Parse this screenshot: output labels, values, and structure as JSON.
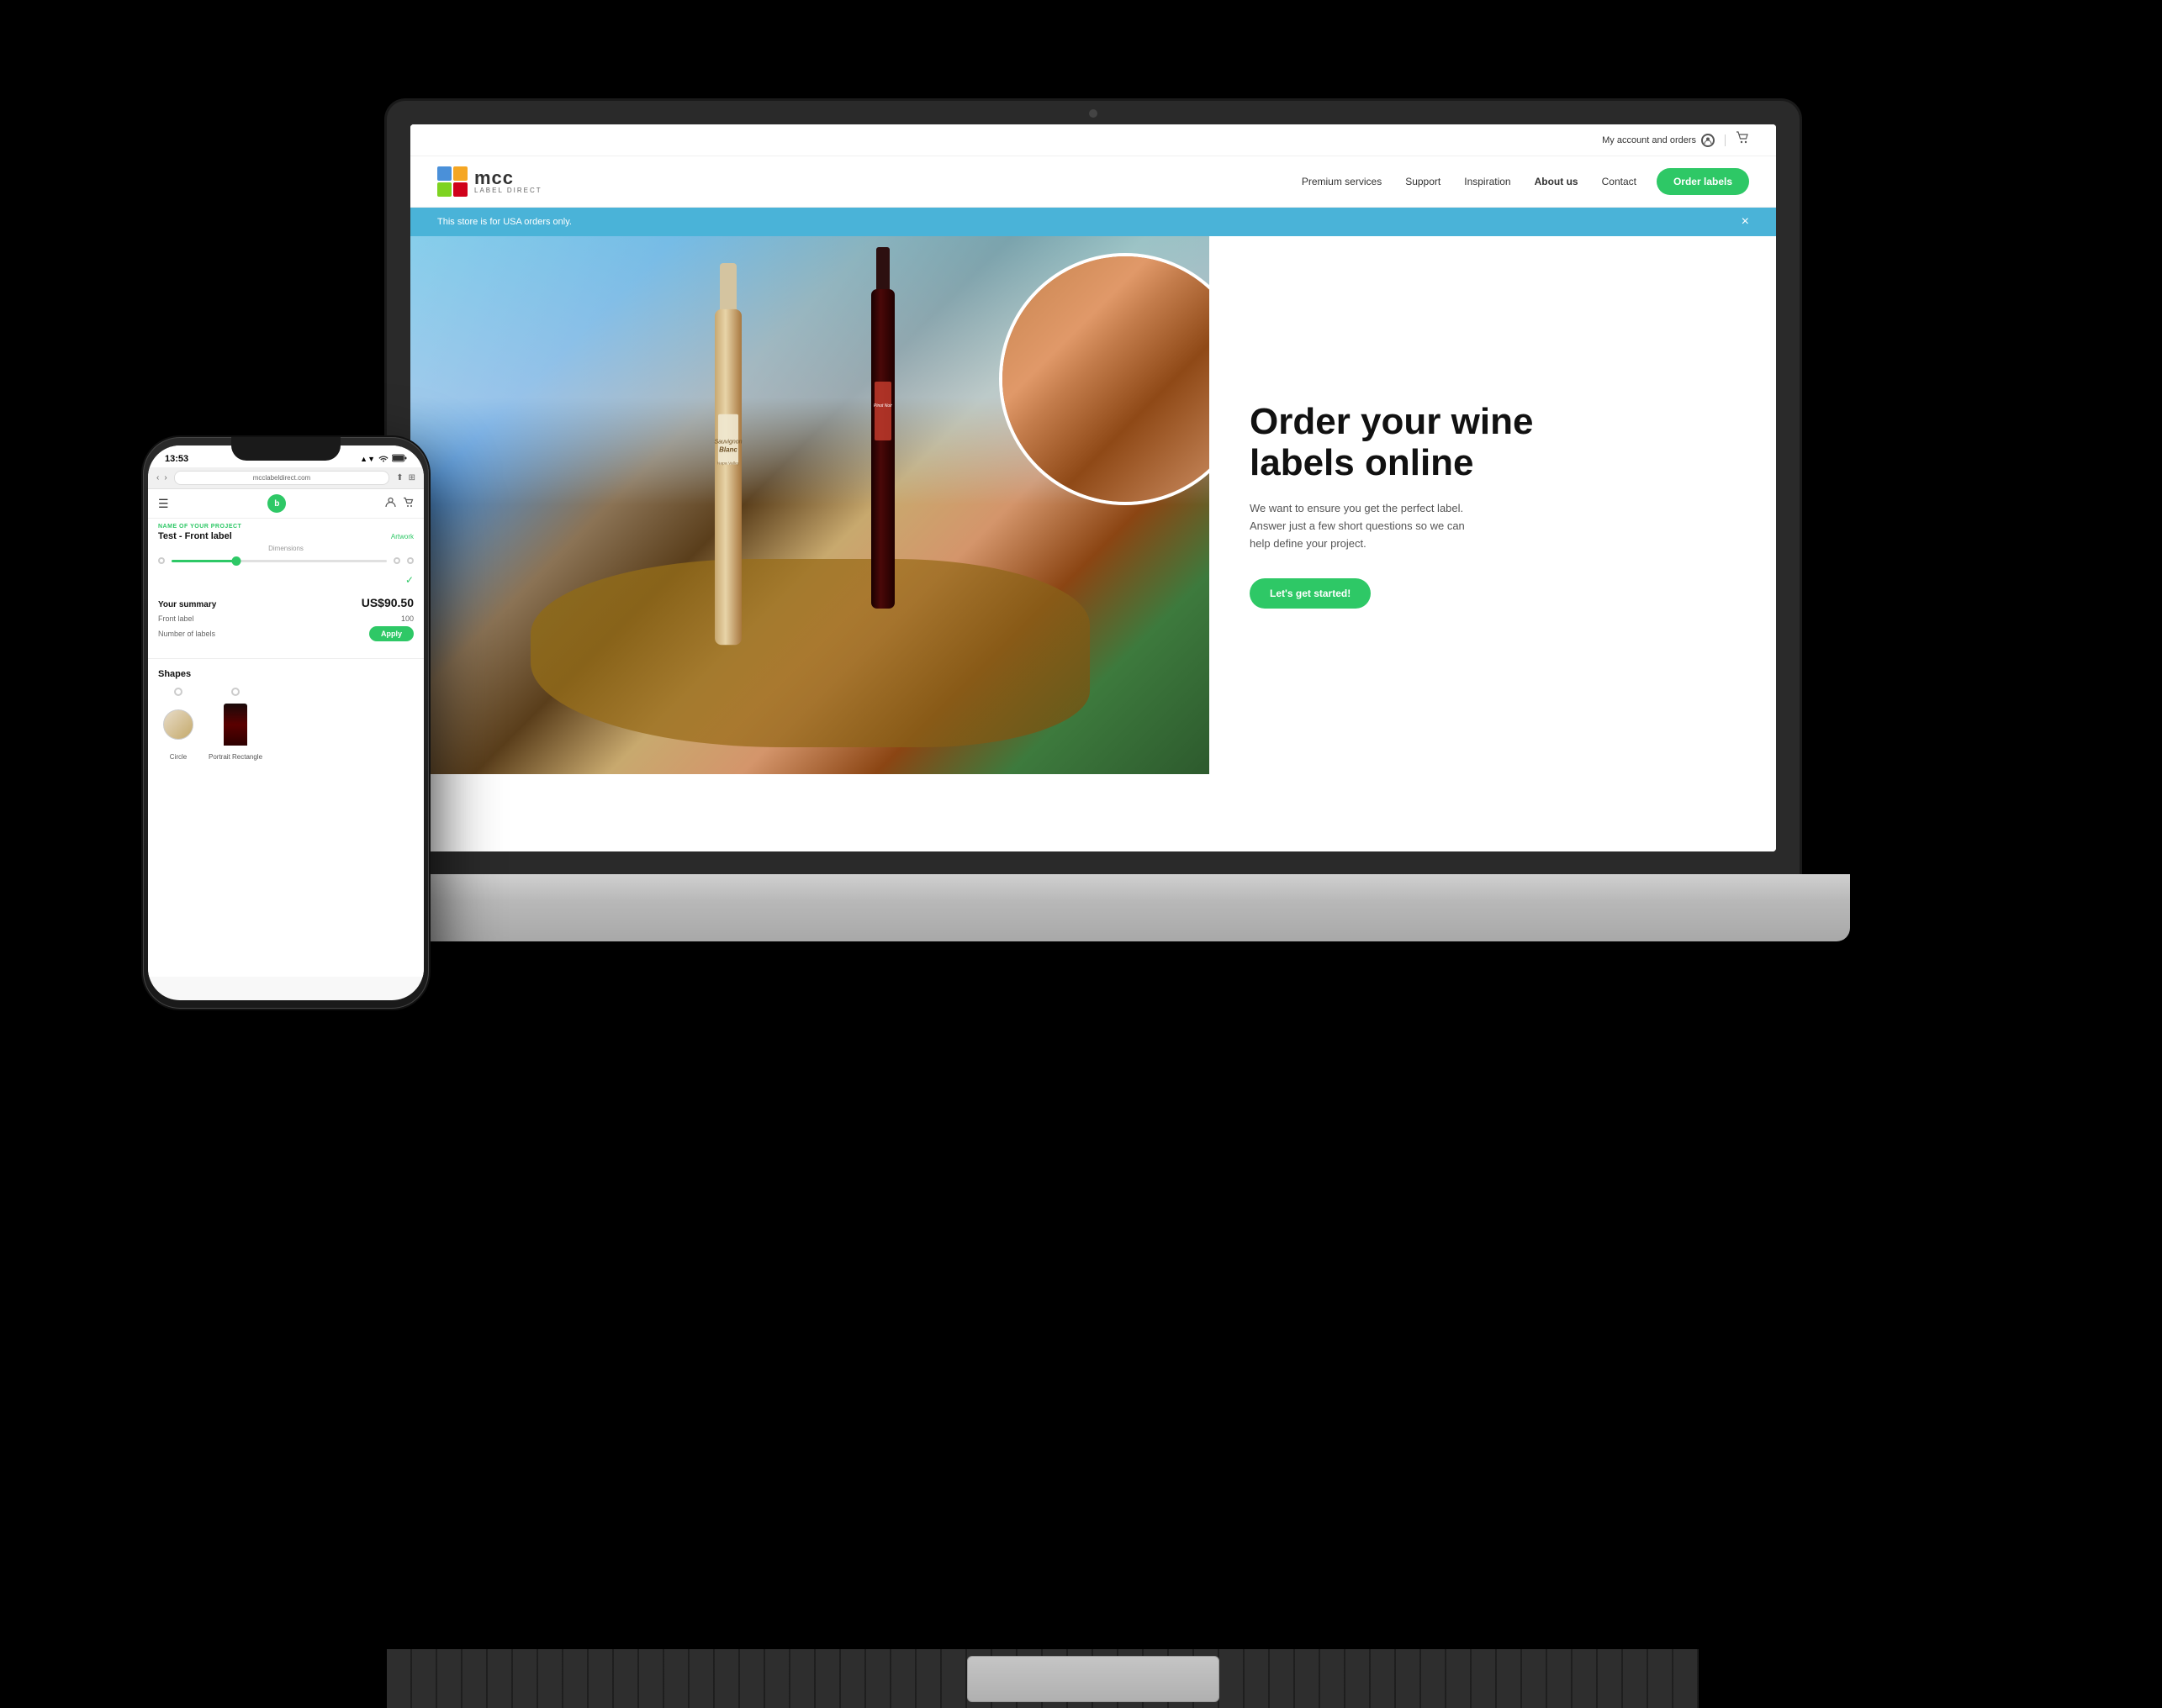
{
  "background": "#000000",
  "laptop": {
    "website": {
      "topbar": {
        "account_label": "My account and orders",
        "divider": true
      },
      "nav": {
        "logo_main": "mcc",
        "logo_sub": "LABEL DIRECT",
        "links": [
          {
            "label": "Premium services"
          },
          {
            "label": "Support"
          },
          {
            "label": "Inspiration"
          },
          {
            "label": "About us"
          },
          {
            "label": "Contact"
          }
        ],
        "cta_button": "Order labels"
      },
      "banner": {
        "text": "This store is for USA orders only.",
        "close": "×"
      },
      "hero": {
        "headline_line1": "Order your wine",
        "headline_line2": "labels online",
        "subtext": "We want to ensure you get the perfect label. Answer just a few short questions so we can help define your project.",
        "cta_button": "Let's get started!"
      }
    }
  },
  "phone": {
    "status_bar": {
      "time": "13:53",
      "signal": "▲▼",
      "wifi": "WiFi",
      "battery": "100"
    },
    "browser": {
      "url": "mcclabeldirect.com"
    },
    "content": {
      "section_label": "NAME OF YOUR PROJECT",
      "project_name": "Test - Front label",
      "artwork_btn": "Artwork",
      "dim_label": "Dimensions",
      "summary_title": "Your summary",
      "summary_price": "US$90.50",
      "front_label": "Front label",
      "front_label_val": "100",
      "num_labels": "Number of labels",
      "apply_btn": "Apply",
      "shapes_title": "Shapes",
      "shapes": [
        {
          "label": "Circle",
          "selected": false
        },
        {
          "label": "Portrait Rectangle",
          "selected": false
        }
      ]
    }
  }
}
